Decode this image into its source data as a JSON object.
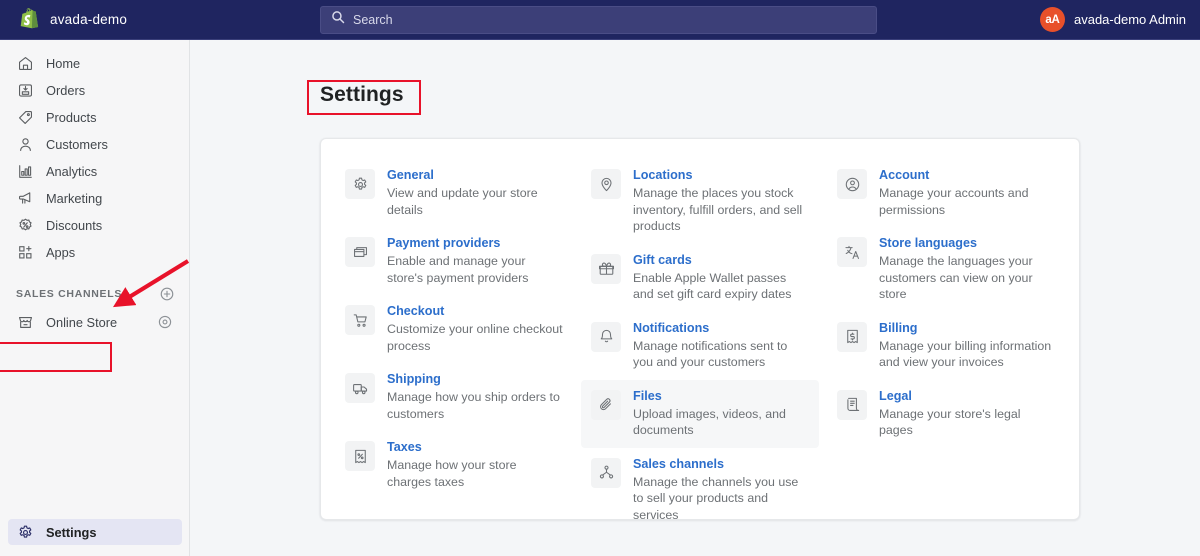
{
  "topbar": {
    "brand_name": "avada-demo",
    "logo_icon": "shopify-logo",
    "search": {
      "icon": "search-icon",
      "placeholder": "Search",
      "value": ""
    },
    "user": {
      "avatar_initials": "aA",
      "name": "avada-demo Admin"
    },
    "background_color": "#1f2560",
    "avatar_color": "#e8502a"
  },
  "sidebar": {
    "items": [
      {
        "label": "Home",
        "icon": "home-icon"
      },
      {
        "label": "Orders",
        "icon": "orders-inbox-icon"
      },
      {
        "label": "Products",
        "icon": "products-tag-icon"
      },
      {
        "label": "Customers",
        "icon": "customers-person-icon"
      },
      {
        "label": "Analytics",
        "icon": "analytics-bar-chart-icon"
      },
      {
        "label": "Marketing",
        "icon": "marketing-megaphone-icon"
      },
      {
        "label": "Discounts",
        "icon": "discounts-percent-icon"
      },
      {
        "label": "Apps",
        "icon": "apps-grid-plus-icon"
      }
    ],
    "section": {
      "title": "SALES CHANNELS",
      "add_icon": "plus-circle-icon",
      "channels": [
        {
          "label": "Online Store",
          "icon": "online-store-icon",
          "trailing_icon": "eye-icon"
        }
      ]
    },
    "footer": {
      "label": "Settings",
      "icon": "gear-icon",
      "active": true
    }
  },
  "main": {
    "page_title": "Settings",
    "columns": [
      [
        {
          "title": "General",
          "desc": "View and update your store details",
          "icon": "gear-icon"
        },
        {
          "title": "Payment providers",
          "desc": "Enable and manage your store's payment providers",
          "icon": "payment-card-icon"
        },
        {
          "title": "Checkout",
          "desc": "Customize your online checkout process",
          "icon": "cart-icon"
        },
        {
          "title": "Shipping",
          "desc": "Manage how you ship orders to customers",
          "icon": "shipping-truck-icon"
        },
        {
          "title": "Taxes",
          "desc": "Manage how your store charges taxes",
          "icon": "taxes-receipt-icon"
        }
      ],
      [
        {
          "title": "Locations",
          "desc": "Manage the places you stock inventory, fulfill orders, and sell products",
          "icon": "location-pin-icon"
        },
        {
          "title": "Gift cards",
          "desc": "Enable Apple Wallet passes and set gift card expiry dates",
          "icon": "gift-card-icon"
        },
        {
          "title": "Notifications",
          "desc": "Manage notifications sent to you and your customers",
          "icon": "bell-icon"
        },
        {
          "title": "Files",
          "desc": "Upload images, videos, and documents",
          "icon": "paperclip-icon",
          "hovered": true
        },
        {
          "title": "Sales channels",
          "desc": "Manage the channels you use to sell your products and services",
          "icon": "sales-channels-node-icon"
        }
      ],
      [
        {
          "title": "Account",
          "desc": "Manage your accounts and permissions",
          "icon": "account-circle-icon"
        },
        {
          "title": "Store languages",
          "desc": "Manage the languages your customers can view on your store",
          "icon": "translate-icon"
        },
        {
          "title": "Billing",
          "desc": "Manage your billing information and view your invoices",
          "icon": "billing-dollar-icon"
        },
        {
          "title": "Legal",
          "desc": "Manage your store's legal pages",
          "icon": "legal-scroll-icon"
        }
      ]
    ],
    "link_color": "#2c6ecb"
  },
  "annotations": {
    "color": "#e8122a",
    "title_highlight": "Settings",
    "sidebar_highlight": "Online Store",
    "arrow_icon": "arrow-pointer-icon"
  }
}
